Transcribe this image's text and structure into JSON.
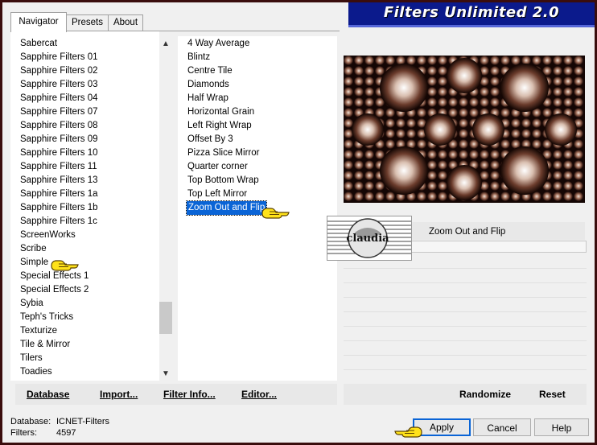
{
  "window": {
    "title": "Filters Unlimited 2.0",
    "accent": "#0b1a8c",
    "frame_color": "#3a0d0d"
  },
  "tabs": [
    {
      "label": "Navigator",
      "active": true
    },
    {
      "label": "Presets",
      "active": false
    },
    {
      "label": "About",
      "active": false
    }
  ],
  "categories": [
    "Sabercat",
    "Sapphire Filters 01",
    "Sapphire Filters 02",
    "Sapphire Filters 03",
    "Sapphire Filters 04",
    "Sapphire Filters 07",
    "Sapphire Filters 08",
    "Sapphire Filters 09",
    "Sapphire Filters 10",
    "Sapphire Filters 11",
    "Sapphire Filters 13",
    "Sapphire Filters 1a",
    "Sapphire Filters 1b",
    "Sapphire Filters 1c",
    "ScreenWorks",
    "Scribe",
    "Simple",
    "Special Effects 1",
    "Special Effects 2",
    "Sybia",
    "Teph's Tricks",
    "Texturize",
    "Tile & Mirror",
    "Tilers",
    "Toadies"
  ],
  "selected_category": "Simple",
  "filters": [
    "4 Way Average",
    "Blintz",
    "Centre Tile",
    "Diamonds",
    "Half Wrap",
    "Horizontal Grain",
    "Left Right Wrap",
    "Offset By 3",
    "Pizza Slice Mirror",
    "Quarter corner",
    "Top Bottom Wrap",
    "Top Left Mirror",
    "Zoom Out and Flip"
  ],
  "selected_filter": "Zoom Out and Flip",
  "preview": {
    "filter_name": "Zoom Out and Flip"
  },
  "logo": {
    "text": "claudia"
  },
  "toolbar": {
    "database_label": "Database",
    "import_label": "Import...",
    "filter_info_label": "Filter Info...",
    "editor_label": "Editor...",
    "randomize_label": "Randomize",
    "reset_label": "Reset"
  },
  "status": {
    "database_label": "Database:",
    "database_value": "ICNET-Filters",
    "filters_label": "Filters:",
    "filters_value": "4597"
  },
  "buttons": {
    "apply_label": "Apply",
    "cancel_label": "Cancel",
    "help_label": "Help"
  },
  "icons": {
    "scroll_up": "scroll-up-arrow-icon",
    "scroll_down": "scroll-down-arrow-icon",
    "pointer": "pointing-hand-icon"
  }
}
